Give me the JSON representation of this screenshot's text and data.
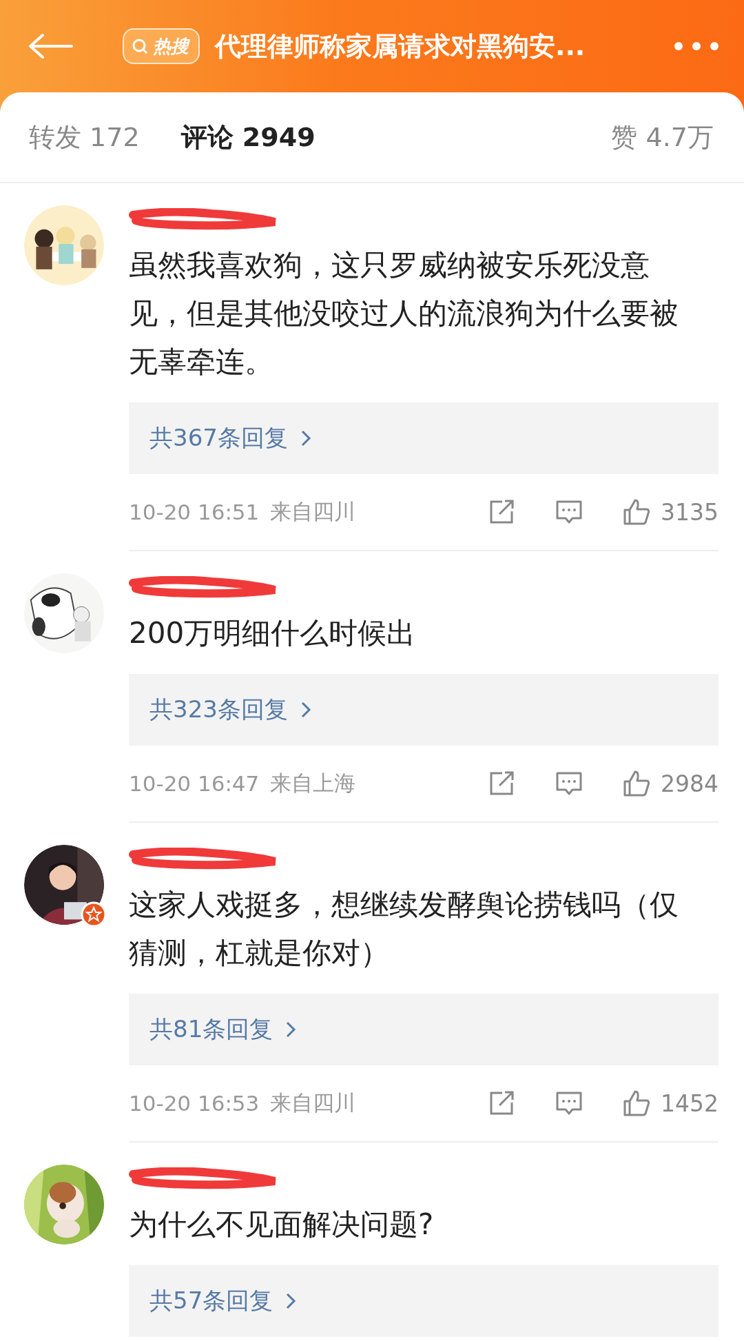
{
  "header": {
    "badge": "热搜",
    "title": "代理律师称家属请求对黑狗安..."
  },
  "tabs": [
    {
      "label": "转发 172",
      "selected": false
    },
    {
      "label": "评论 2949",
      "selected": true
    }
  ],
  "likes_tab": {
    "label": "赞 4.7万"
  },
  "comments": [
    {
      "verified": false,
      "text": "虽然我喜欢狗，这只罗威纳被安乐死没意见，但是其他没咬过人的流浪狗为什么要被无辜牵连。",
      "replies": "共367条回复",
      "time": "10-20 16:51",
      "location": "来自四川",
      "likes": "3135"
    },
    {
      "verified": false,
      "text": "200万明细什么时候出",
      "replies": "共323条回复",
      "time": "10-20 16:47",
      "location": "来自上海",
      "likes": "2984"
    },
    {
      "verified": true,
      "text": "这家人戏挺多，想继续发酵舆论捞钱吗（仅猜测，杠就是你对）",
      "replies": "共81条回复",
      "time": "10-20 16:53",
      "location": "来自四川",
      "likes": "1452"
    },
    {
      "verified": false,
      "text": "为什么不见面解决问题?",
      "replies": "共57条回复"
    }
  ]
}
